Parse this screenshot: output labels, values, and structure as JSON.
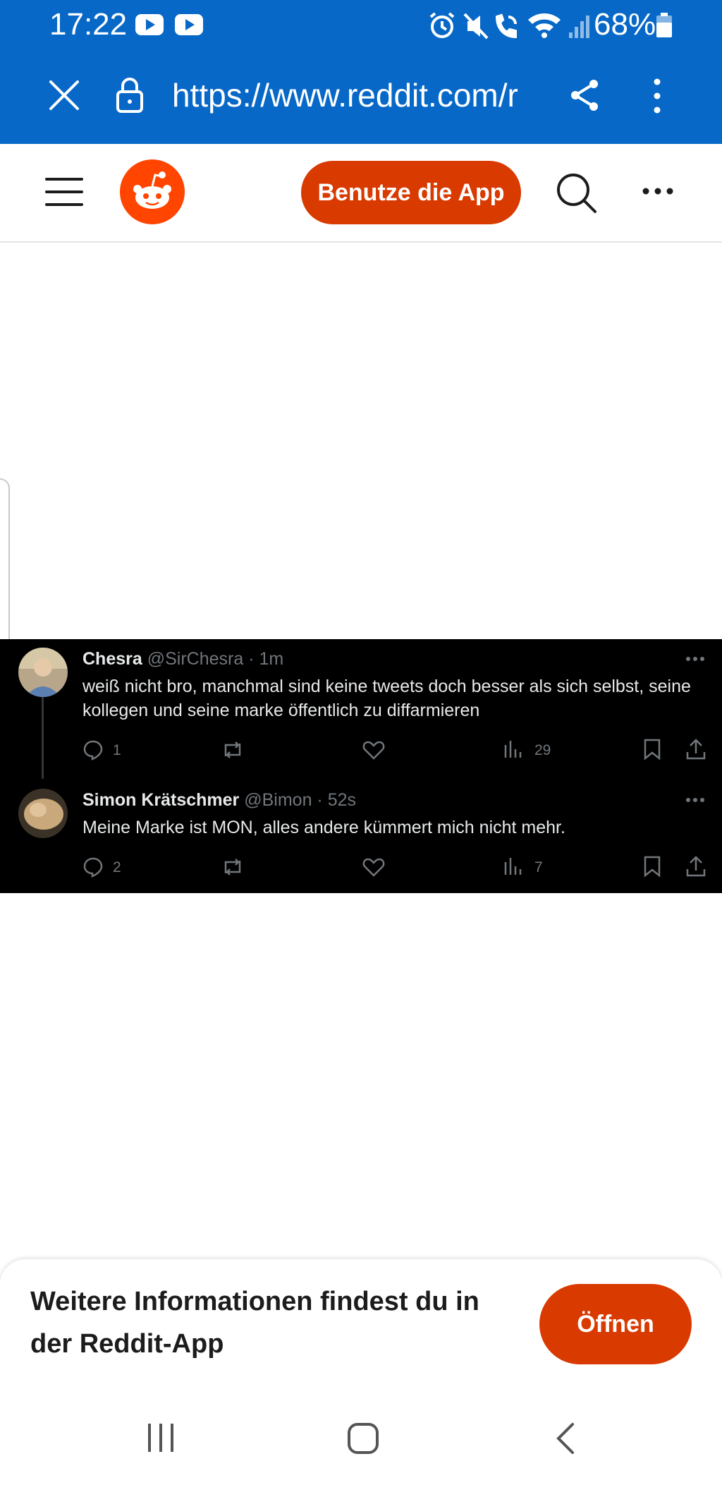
{
  "status_bar": {
    "time": "17:22",
    "battery": "68%",
    "icons": [
      "youtube-icon",
      "youtube-icon",
      "alarm-icon",
      "mute-icon",
      "wifi-call-icon",
      "wifi-icon",
      "signal-icon",
      "battery-icon"
    ]
  },
  "browser": {
    "url": "https://www.reddit.com/r",
    "icons": [
      "close-icon",
      "lock-icon",
      "share-icon",
      "more-vertical-icon"
    ]
  },
  "site_header": {
    "use_app_label": "Benutze die App",
    "icons": [
      "menu-icon",
      "reddit-logo-icon",
      "search-icon",
      "more-horizontal-icon"
    ]
  },
  "tweets": [
    {
      "name": "Chesra",
      "handle": "@SirChesra · 1m",
      "text": "weiß nicht bro, manchmal sind keine tweets doch besser als sich selbst, seine kollegen und seine marke öffentlich zu diffarmieren",
      "replies": "1",
      "views": "29"
    },
    {
      "name": "Simon Krätschmer",
      "handle": "@Bimon · 52s",
      "text": "Meine Marke ist MON, alles andere kümmert mich nicht mehr.",
      "replies": "2",
      "views": "7"
    }
  ],
  "banner": {
    "text": "Weitere Informationen findest du in der Reddit-App",
    "open_label": "Öffnen"
  },
  "colors": {
    "browser_blue": "#0768c7",
    "reddit_orange": "#ff4500",
    "button_orange": "#d93a00",
    "tweet_bg": "#000000"
  }
}
